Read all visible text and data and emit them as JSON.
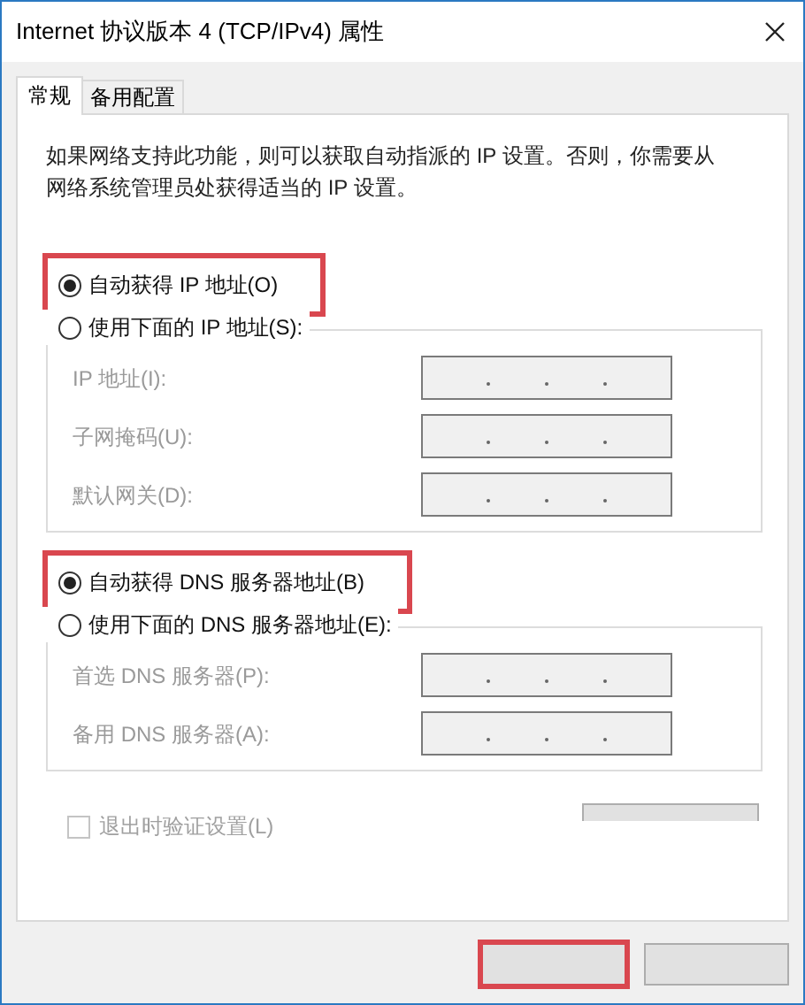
{
  "window": {
    "title": "Internet 协议版本 4 (TCP/IPv4) 属性"
  },
  "tabs": [
    {
      "label": "常规",
      "selected": true
    },
    {
      "label": "备用配置",
      "selected": false
    }
  ],
  "description": "如果网络支持此功能，则可以获取自动指派的 IP 设置。否则，你需要从网络系统管理员处获得适当的 IP 设置。",
  "ip_section": {
    "options": [
      {
        "label": "自动获得 IP 地址(O)",
        "selected": true,
        "highlighted": true
      },
      {
        "label": "使用下面的 IP 地址(S):",
        "selected": false,
        "highlighted": false
      }
    ],
    "fields": [
      {
        "label": "IP 地址(I):",
        "disabled": true
      },
      {
        "label": "子网掩码(U):",
        "disabled": true
      },
      {
        "label": "默认网关(D):",
        "disabled": true
      }
    ]
  },
  "dns_section": {
    "options": [
      {
        "label": "自动获得 DNS 服务器地址(B)",
        "selected": true,
        "highlighted": true
      },
      {
        "label": "使用下面的 DNS 服务器地址(E):",
        "selected": false,
        "highlighted": false
      }
    ],
    "fields": [
      {
        "label": "首选 DNS 服务器(P):",
        "disabled": true
      },
      {
        "label": "备用 DNS 服务器(A):",
        "disabled": true
      }
    ]
  },
  "validate_checkbox": {
    "label": "退出时验证设置(L)",
    "checked": false,
    "disabled": true
  },
  "buttons": [
    {
      "highlighted": true
    },
    {
      "highlighted": false
    }
  ]
}
